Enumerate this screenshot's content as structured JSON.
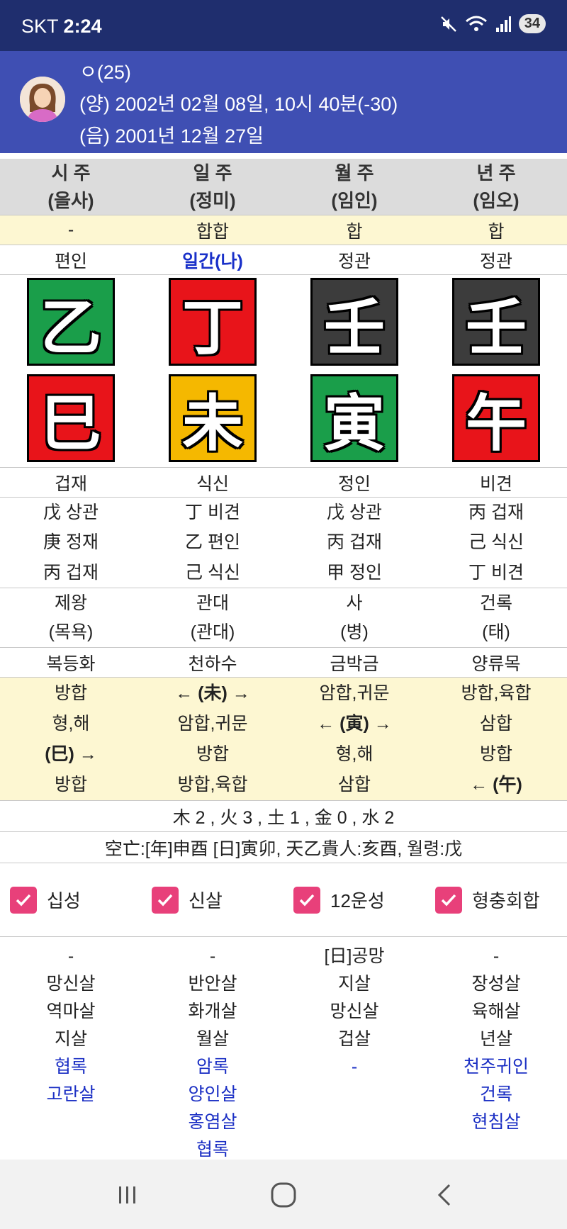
{
  "status_bar": {
    "carrier": "SKT",
    "time": "2:24",
    "battery": "34",
    "icons": [
      "mute-icon",
      "wifi-icon",
      "signal-icon",
      "battery-icon"
    ]
  },
  "profile": {
    "name": "ㅇ(25)",
    "solar": "(양) 2002년 02월 08일, 10시 40분(-30)",
    "lunar": "(음) 2001년 12월 27일"
  },
  "pillars": {
    "titles": [
      "시 주",
      "일 주",
      "월 주",
      "년 주"
    ],
    "subtitles": [
      "(을사)",
      "(정미)",
      "(임인)",
      "(임오)"
    ],
    "combos": [
      "-",
      "합합",
      "합",
      "합"
    ],
    "stem_gods": [
      "편인",
      "일간(나)",
      "정관",
      "정관"
    ],
    "stems": [
      {
        "char": "乙",
        "color": "#1a9e4a"
      },
      {
        "char": "丁",
        "color": "#e8141a"
      },
      {
        "char": "壬",
        "color": "#3c3c3c"
      },
      {
        "char": "壬",
        "color": "#3c3c3c"
      }
    ],
    "branches": [
      {
        "char": "巳",
        "color": "#e8141a"
      },
      {
        "char": "未",
        "color": "#f5b800"
      },
      {
        "char": "寅",
        "color": "#1a9e4a"
      },
      {
        "char": "午",
        "color": "#e8141a"
      }
    ],
    "branch_gods": [
      "겁재",
      "식신",
      "정인",
      "비견"
    ],
    "hidden_stems": [
      [
        "戊 상관",
        "庚 정재",
        "丙 겁재"
      ],
      [
        "丁 비견",
        "乙 편인",
        "己 식신"
      ],
      [
        "戊 상관",
        "丙 겁재",
        "甲 정인"
      ],
      [
        "丙 겁재",
        "己 식신",
        "丁 비견"
      ]
    ],
    "twelve_stages": [
      [
        "제왕",
        "(목욕)"
      ],
      [
        "관대",
        "(관대)"
      ],
      [
        "사",
        "(병)"
      ],
      [
        "건록",
        "(태)"
      ]
    ],
    "napeum": [
      "복등화",
      "천하수",
      "금박금",
      "양류목"
    ],
    "relations": [
      [
        "방합",
        "형,해",
        "(巳) →",
        "방합"
      ],
      [
        "← (未) →",
        "암합,귀문",
        "방합",
        "방합,육합"
      ],
      [
        "암합,귀문",
        "← (寅) →",
        "형,해",
        "삼합"
      ],
      [
        "방합,육합",
        "삼합",
        "방합",
        "← (午)"
      ]
    ]
  },
  "elements_summary": "木 2 , 火 3 , 土 1 , 金 0 , 水 2",
  "kongmang_line": "空亡:[年]申酉 [日]寅卯, 天乙貴人:亥酉, 월령:戊",
  "checkboxes": [
    {
      "label": "십성",
      "checked": true
    },
    {
      "label": "신살",
      "checked": true
    },
    {
      "label": "12운성",
      "checked": true
    },
    {
      "label": "형충회합",
      "checked": true
    }
  ],
  "sinsal": {
    "black": [
      [
        "-",
        "망신살",
        "역마살",
        "지살"
      ],
      [
        "-",
        "반안살",
        "화개살",
        "월살"
      ],
      [
        "[日]공망",
        "지살",
        "망신살",
        "겁살"
      ],
      [
        "-",
        "장성살",
        "육해살",
        "년살"
      ]
    ],
    "blue": [
      [
        "협록",
        "고란살"
      ],
      [
        "암록",
        "양인살",
        "홍염살",
        "협록"
      ],
      [
        "-"
      ],
      [
        "천주귀인",
        "건록",
        "현침살"
      ]
    ]
  },
  "colors": {
    "status_bar": "#1f2e6e",
    "header": "#3f4fb3",
    "accent_blue": "#1930c9",
    "checkbox": "#e8407a",
    "highlight_row": "#fdf7d2"
  }
}
